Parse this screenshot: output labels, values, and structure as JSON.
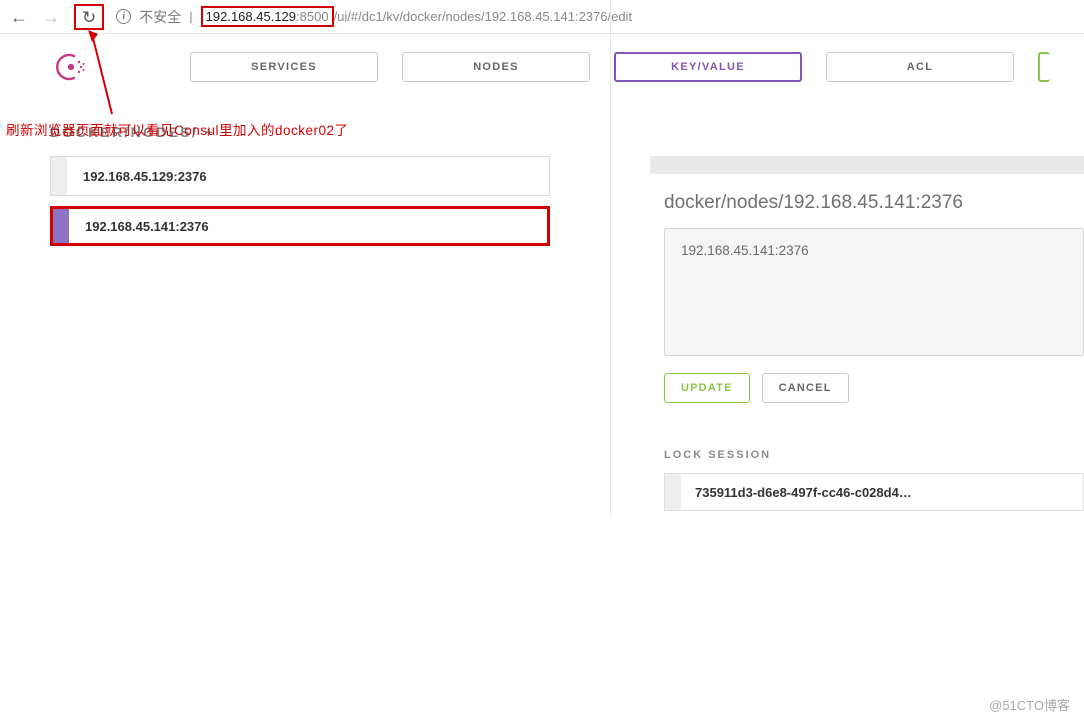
{
  "browser": {
    "insecure_label": "不安全",
    "url_host": "192.168.45.129",
    "url_port": ":8500",
    "url_path": "/ui/#/dc1/kv/docker/nodes/192.168.45.141:2376/edit"
  },
  "annotation": "刷新浏览器页面就可以看见Consul里加入的docker02了",
  "nav": {
    "services": "SERVICES",
    "nodes": "NODES",
    "keyvalue": "KEY/VALUE",
    "acl": "ACL"
  },
  "breadcrumb": "DOCKER/NODES/ +",
  "nodes_list": [
    {
      "label": "192.168.45.129:2376",
      "selected": false
    },
    {
      "label": "192.168.45.141:2376",
      "selected": true
    }
  ],
  "editor": {
    "title": "docker/nodes/192.168.45.141:2376",
    "value": "192.168.45.141:2376",
    "update_label": "UPDATE",
    "cancel_label": "CANCEL"
  },
  "lock_session": {
    "heading": "LOCK SESSION",
    "id": "735911d3-d6e8-497f-cc46-c028d4…"
  },
  "watermark": "@51CTO博客"
}
